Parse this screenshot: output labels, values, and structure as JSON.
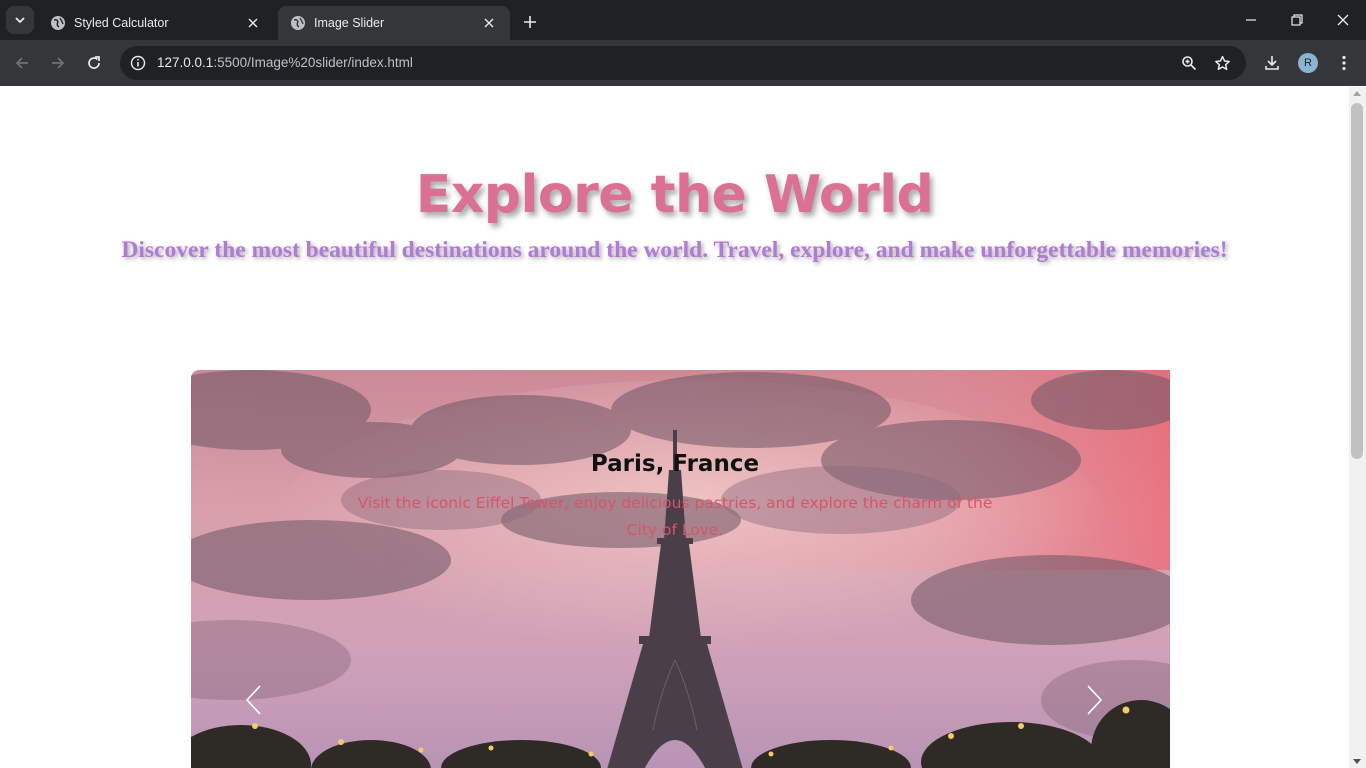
{
  "browser": {
    "tabs": [
      {
        "title": "Styled Calculator",
        "active": false
      },
      {
        "title": "Image Slider",
        "active": true
      }
    ],
    "url_host": "127.0.0.1",
    "url_rest": ":5500/Image%20slider/index.html",
    "profile_initial": "R"
  },
  "hero": {
    "title": "Explore the World",
    "subtitle": "Discover the most beautiful destinations around the world. Travel, explore, and make unforgettable memories!"
  },
  "slide": {
    "title": "Paris, France",
    "description": "Visit the iconic Eiffel Tower, enjoy delicious pastries, and explore the charm of the City of Love."
  },
  "colors": {
    "title": "#db7093",
    "subtitle": "#b07ad6",
    "caption_text": "#d9546a"
  }
}
